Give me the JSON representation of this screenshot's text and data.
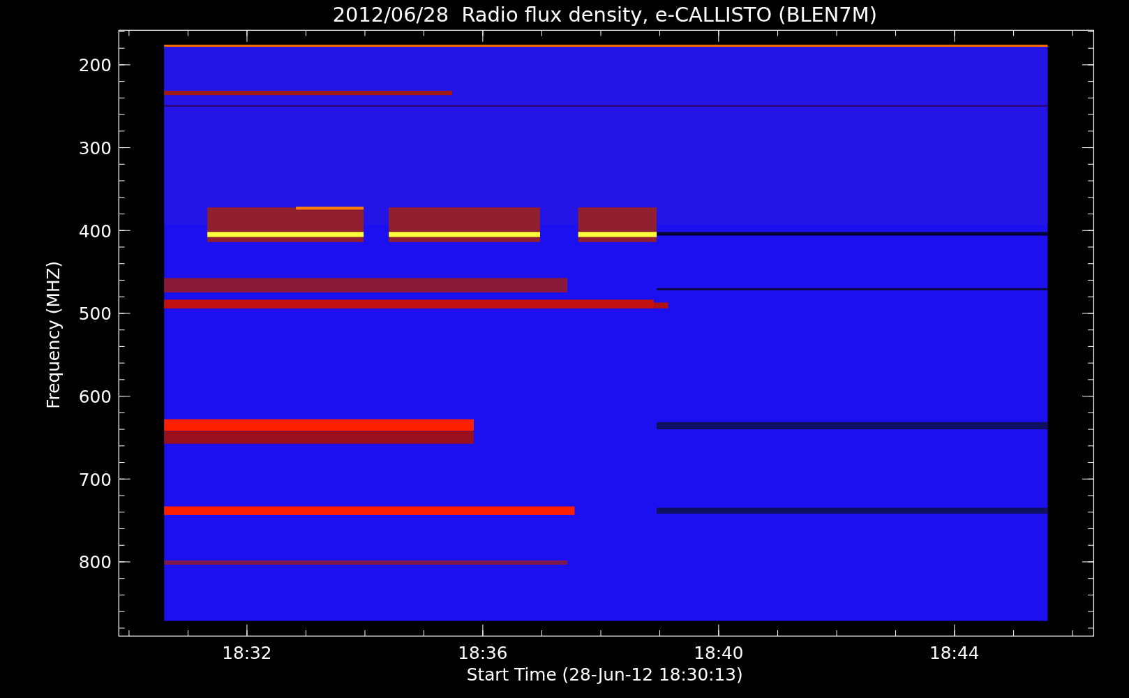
{
  "title": "2012/06/28  Radio flux density, e-CALLISTO (BLEN7M)",
  "plot": {
    "ylabel": "Frequency (MHZ)",
    "xlabel": "Start Time (28-Jun-12 18:30:13)",
    "yticks": [
      "200",
      "300",
      "400",
      "500",
      "600",
      "700",
      "800"
    ],
    "xticks": [
      "18:32",
      "18:36",
      "18:40",
      "18:44"
    ]
  }
}
